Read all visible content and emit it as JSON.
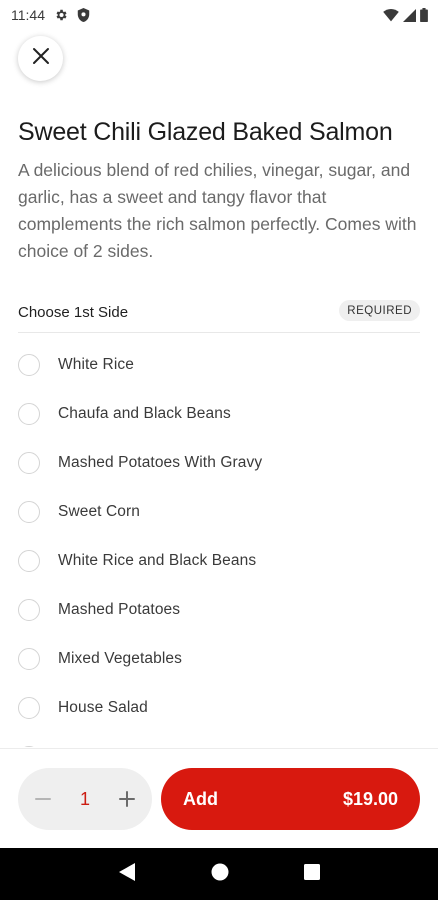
{
  "status_bar": {
    "time": "11:44"
  },
  "item": {
    "title": "Sweet Chili Glazed Baked Salmon",
    "description": "A delicious blend of red chilies, vinegar, sugar, and garlic, has a sweet and tangy flavor that complements the rich salmon perfectly. Comes with choice of 2 sides."
  },
  "section": {
    "title": "Choose 1st Side",
    "badge": "REQUIRED"
  },
  "options": [
    "White Rice",
    "Chaufa and Black Beans",
    "Mashed Potatoes With Gravy",
    "Sweet Corn",
    "White Rice and Black Beans",
    "Mashed Potatoes",
    "Mixed Vegetables",
    "House Salad"
  ],
  "quantity": {
    "value": "1"
  },
  "add_button": {
    "label": "Add",
    "price": "$19.00"
  },
  "colors": {
    "accent": "#d8190f",
    "qty_text": "#cc1d12"
  }
}
